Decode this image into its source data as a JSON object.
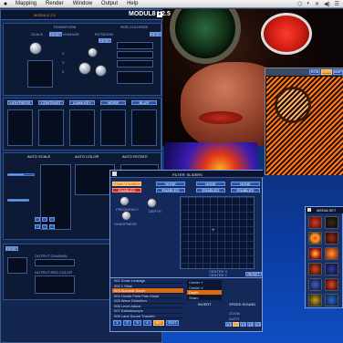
{
  "menubar": {
    "apple": "",
    "items": [
      "Mapping",
      "Render",
      "Window",
      "Output",
      "Help"
    ],
    "status": [
      "⬡",
      "◐",
      "✕",
      "◀)",
      "☰"
    ]
  },
  "main_window": {
    "left_title": "MODULE 2.5",
    "title": "MODUL8 V2.5",
    "sections": {
      "transform": "TRANSFORM",
      "rgb_colorize": "RGB COLORIZE",
      "scale": "SCALE",
      "homage": "HOMAGE",
      "rotation": "ROTATION",
      "reset": "RESET",
      "lightness": "LIGHTNESS",
      "contrast": "CONTRAST",
      "luma_key": "LUMA KEY",
      "noise": "NOISE",
      "blur": "BLUR",
      "auto_scale": "AUTO SCALE",
      "auto_color": "AUTO COLOR",
      "auto_rotate": "AUTO ROTATE",
      "output_channel": "OUTPUT CHANNEL",
      "output_red_color": "OUTPUT RED COLOR"
    },
    "axes": [
      "X",
      "Y",
      "Z"
    ]
  },
  "filter_window": {
    "title": "FILTER: SLIDERS",
    "tabs": [
      "NONE",
      "NONE",
      "NONE"
    ],
    "states": [
      "ENABLED",
      "ENABLED",
      "ENABLED"
    ],
    "selected_filter": "AUTOMATIC ZOOM",
    "knobs": [
      "FREQUENCY",
      "DEPTH",
      "SHARPNESS"
    ],
    "xy_label": "CENTER X",
    "xy_label2": "CENTER Y",
    "reset": "RESET"
  },
  "effects_list": {
    "items": [
      "001 Scale Leakage",
      "002 1 Slide",
      "003 Automat Zoom",
      "004 Height Field Plan Mode",
      "005 Wave Distortion",
      "006 Level Adjust",
      "007 Kaleidoscope",
      "008 Lava Sound Transfer"
    ],
    "selected_index": 2,
    "pager": [
      "1",
      "2",
      "3",
      "4",
      "ALL",
      "EDIT"
    ],
    "right_items": [
      "Center Y",
      "Center X",
      "Depth",
      "Sharp"
    ],
    "options": [
      "INVERT",
      "SPEED SOUND",
      "ZOOM",
      "AUTO"
    ],
    "speed_buttons": [
      "1/1",
      "1/2",
      "1/4",
      "1/8",
      "1/16"
    ]
  },
  "media_set": {
    "title": "MEDIA SET"
  },
  "preview_badges": [
    "RGB",
    "LAYER",
    "MAP"
  ]
}
